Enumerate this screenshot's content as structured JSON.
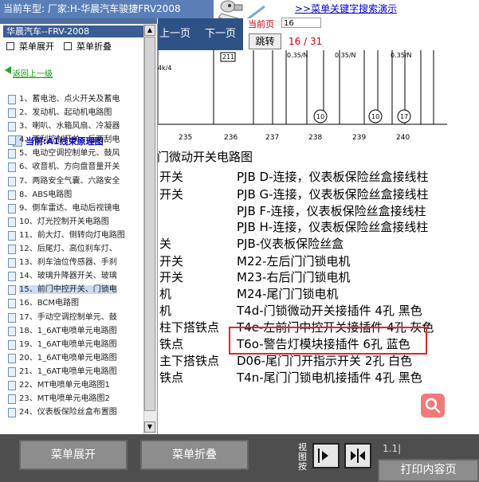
{
  "app": {
    "vehicle_label": "当前车型:   厂家:H-华晨汽车骏捷FRV2008",
    "search_demo_link": ">>菜单关键字搜索演示"
  },
  "sidebar": {
    "title": "华晨汽车--FRV-2008",
    "expand_label": "菜单展开",
    "collapse_label": "菜单折叠",
    "back_label": "返回上一级",
    "current_label": "当前:A1线束原理图",
    "items": [
      {
        "label": "1、蓄电池、点火开关及蓄电"
      },
      {
        "label": "2、发动机、起动机电路图"
      },
      {
        "label": "3、喇叭、水箱风扇、冷凝器"
      },
      {
        "label": "4、两刮控制开关、后两刮电"
      },
      {
        "label": "5、电动空调控制单元、鼓风"
      },
      {
        "label": "6、收音机、方向盘音量开关"
      },
      {
        "label": "7、两路安全气囊、六路安全"
      },
      {
        "label": "8、ABS电路图"
      },
      {
        "label": "9、倒车雷达、电动后视镜电"
      },
      {
        "label": "10、灯光控制开关电路图"
      },
      {
        "label": "11、前大灯、侧转向灯电路图"
      },
      {
        "label": "12、后尾灯、高位刹车灯、"
      },
      {
        "label": "13、刹车油位传感器、手刹"
      },
      {
        "label": "14、玻璃升降器开关、玻璃"
      },
      {
        "label": "15、前门中控开关、门锁电"
      },
      {
        "label": "16、BCM电路图"
      },
      {
        "label": "17、手动空调控制单元、鼓"
      },
      {
        "label": "18、1_6AT电喷单元电路图"
      },
      {
        "label": "19、1_6AT电喷单元电路图"
      },
      {
        "label": "20、1_6AT电喷单元电路图"
      },
      {
        "label": "21、1_6AT电喷单元电路图"
      },
      {
        "label": "22、MT电喷单元电路图1"
      },
      {
        "label": "23、MT电喷单元电路图2"
      },
      {
        "label": "24、仪表板保险丝盒布置图"
      }
    ]
  },
  "nav": {
    "prev_label": "上一页",
    "next_label": "下一页",
    "page_label": "当前页",
    "page_input_value": "16",
    "jump_label": "跳转",
    "page_count": "16 / 31"
  },
  "diagram": {
    "left_label": "4k/4",
    "box_label": "211",
    "wire1_label": "0.35/N",
    "wire2_label": "0.35/N",
    "wire3_label": "0.35/N",
    "circle1": "10",
    "circle2": "10",
    "circle3": "17",
    "ticks": [
      "235",
      "236",
      "237",
      "238",
      "239",
      "240"
    ]
  },
  "content": {
    "section_title": "门微动开关电路图",
    "rows": [
      {
        "left": "开关",
        "right": "PJB D-连接，仪表板保险丝盒接线柱"
      },
      {
        "left": "开关",
        "right": "PJB G-连接，仪表板保险丝盒接线柱"
      },
      {
        "left": "",
        "right": "PJB F-连接，仪表板保险丝盒接线柱"
      },
      {
        "left": "",
        "right": "PJB H-连接，仪表板保险丝盒接线柱"
      },
      {
        "left": "关",
        "right": "PJB-仪表板保险丝盒"
      },
      {
        "left": "开关",
        "right": "M22-左后门门锁电机"
      },
      {
        "left": "开关",
        "right": "M23-右后门门锁电机"
      },
      {
        "left": "机",
        "right": "M24-尾门门锁电机"
      },
      {
        "left": "机",
        "right": "T4d-门锁微动开关接插件 4孔 黑色"
      },
      {
        "left": "柱下搭铁点",
        "right": "T4e-左前门中控开关接插件 4孔 灰色"
      },
      {
        "left": "铁点",
        "right": "T6o-警告灯模块接插件 6孔 蓝色"
      },
      {
        "left": "主下搭铁点",
        "right": "D06-尾门门开指示开关 2孔 白色"
      },
      {
        "left": "铁点",
        "right": "T4n-尾门门锁电机接插件 4孔 黑色"
      }
    ]
  },
  "toolbar": {
    "expand_label": "菜单展开",
    "collapse_label": "菜单折叠",
    "view_label": "视图按",
    "zoom_label": "1.1|",
    "print_label": "打印内容页"
  },
  "colors": {
    "header_blue": "#5a7fb8",
    "nav_dark": "#2f5286",
    "highlight_red": "#e0262c",
    "toolbar_gray": "#4e4e4e",
    "link_blue": "#0000cc"
  }
}
